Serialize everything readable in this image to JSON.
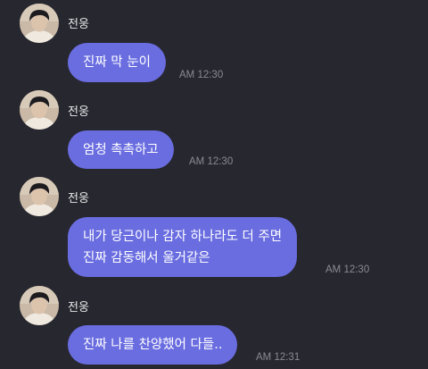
{
  "colors": {
    "background": "#27272f",
    "bubble": "#6a6de0",
    "bubble_text": "#ffffff",
    "name_text": "#e6e6ea",
    "time_text": "#8a8a92"
  },
  "messages": [
    {
      "sender": "전웅",
      "avatar": "profile-photo",
      "lines": [
        "진짜 막 눈이"
      ],
      "time": "AM 12:30"
    },
    {
      "sender": "전웅",
      "avatar": "profile-photo",
      "lines": [
        "엄청 촉촉하고"
      ],
      "time": "AM 12:30"
    },
    {
      "sender": "전웅",
      "avatar": "profile-photo",
      "lines": [
        "내가 당근이나 감자 하나라도 더 주면",
        "진짜 감동해서 울거같은"
      ],
      "time": "AM 12:30"
    },
    {
      "sender": "전웅",
      "avatar": "profile-photo",
      "lines": [
        "진짜 나를 찬양했어 다들.."
      ],
      "time": "AM 12:31"
    }
  ]
}
